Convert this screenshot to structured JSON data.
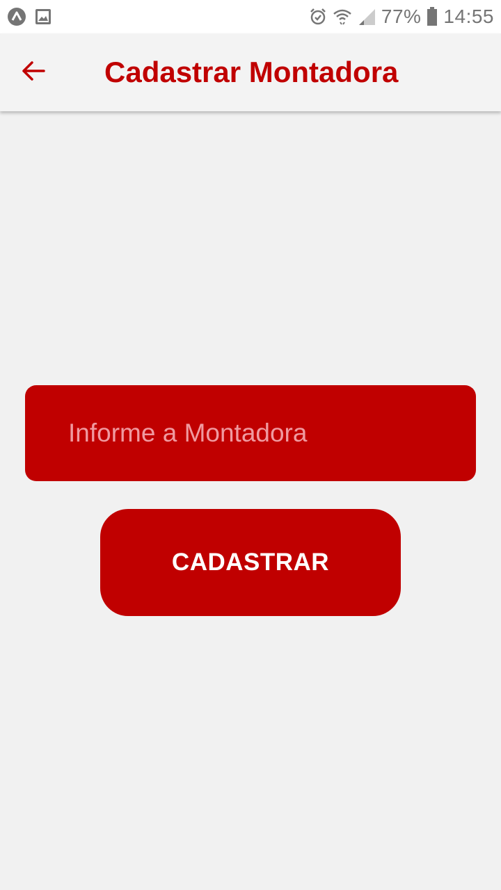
{
  "status_bar": {
    "battery": "77%",
    "time": "14:55",
    "icons": [
      "app-launcher-icon",
      "image-notification-icon",
      "alarm-icon",
      "wifi-icon",
      "signal-icon",
      "battery-icon"
    ]
  },
  "app_bar": {
    "title": "Cadastrar Montadora",
    "back_icon": "arrow-left-icon"
  },
  "form": {
    "input_placeholder": "Informe a Montadora",
    "input_value": "",
    "submit_label": "CADASTRAR"
  },
  "colors": {
    "primary": "#c00000",
    "background": "#f1f1f1",
    "placeholder": "#f09aa0",
    "status_icons": "#757575"
  }
}
